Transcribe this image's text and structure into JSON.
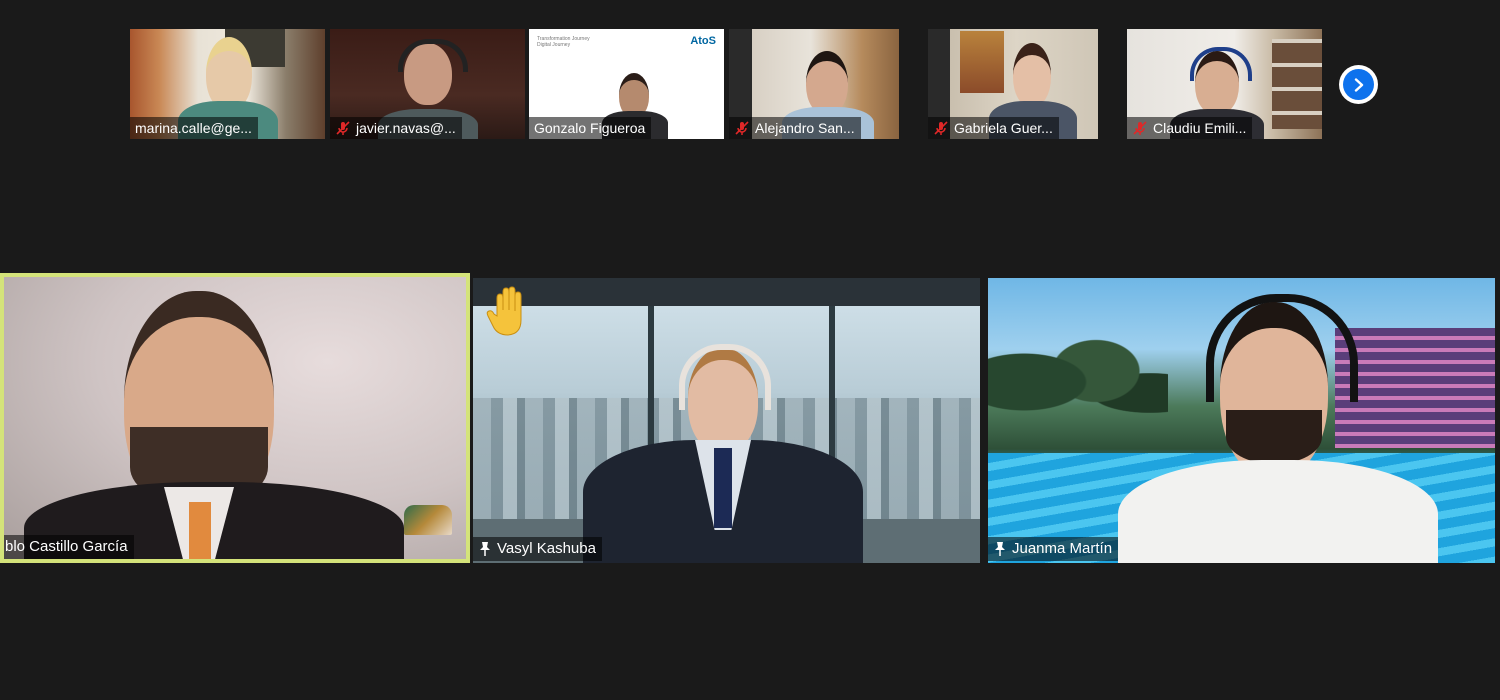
{
  "thumbnails": [
    {
      "name": "marina.calle@ge...",
      "muted": false
    },
    {
      "name": "javier.navas@...",
      "muted": true
    },
    {
      "name": "Gonzalo Figueroa",
      "muted": false,
      "slide_logo": "AtoS",
      "slide_lines": [
        "Transformation Journey",
        "Digital Journey"
      ]
    },
    {
      "name": "Alejandro San...",
      "muted": true
    },
    {
      "name": "Gabriela Guer...",
      "muted": true
    },
    {
      "name": "Claudiu Emili...",
      "muted": true
    }
  ],
  "next_page_icon": "chevron-right-icon",
  "tiles": [
    {
      "name": "blo Castillo García",
      "active_speaker": true,
      "pinned": false
    },
    {
      "name": "Vasyl Kashuba",
      "pinned": true,
      "raised_hand": true
    },
    {
      "name": "Juanma Martín",
      "pinned": true
    }
  ],
  "colors": {
    "background": "#1a1a1a",
    "active_speaker_border": "#d4e37a",
    "next_button": "#0e72ed",
    "muted_icon": "#e02828"
  }
}
